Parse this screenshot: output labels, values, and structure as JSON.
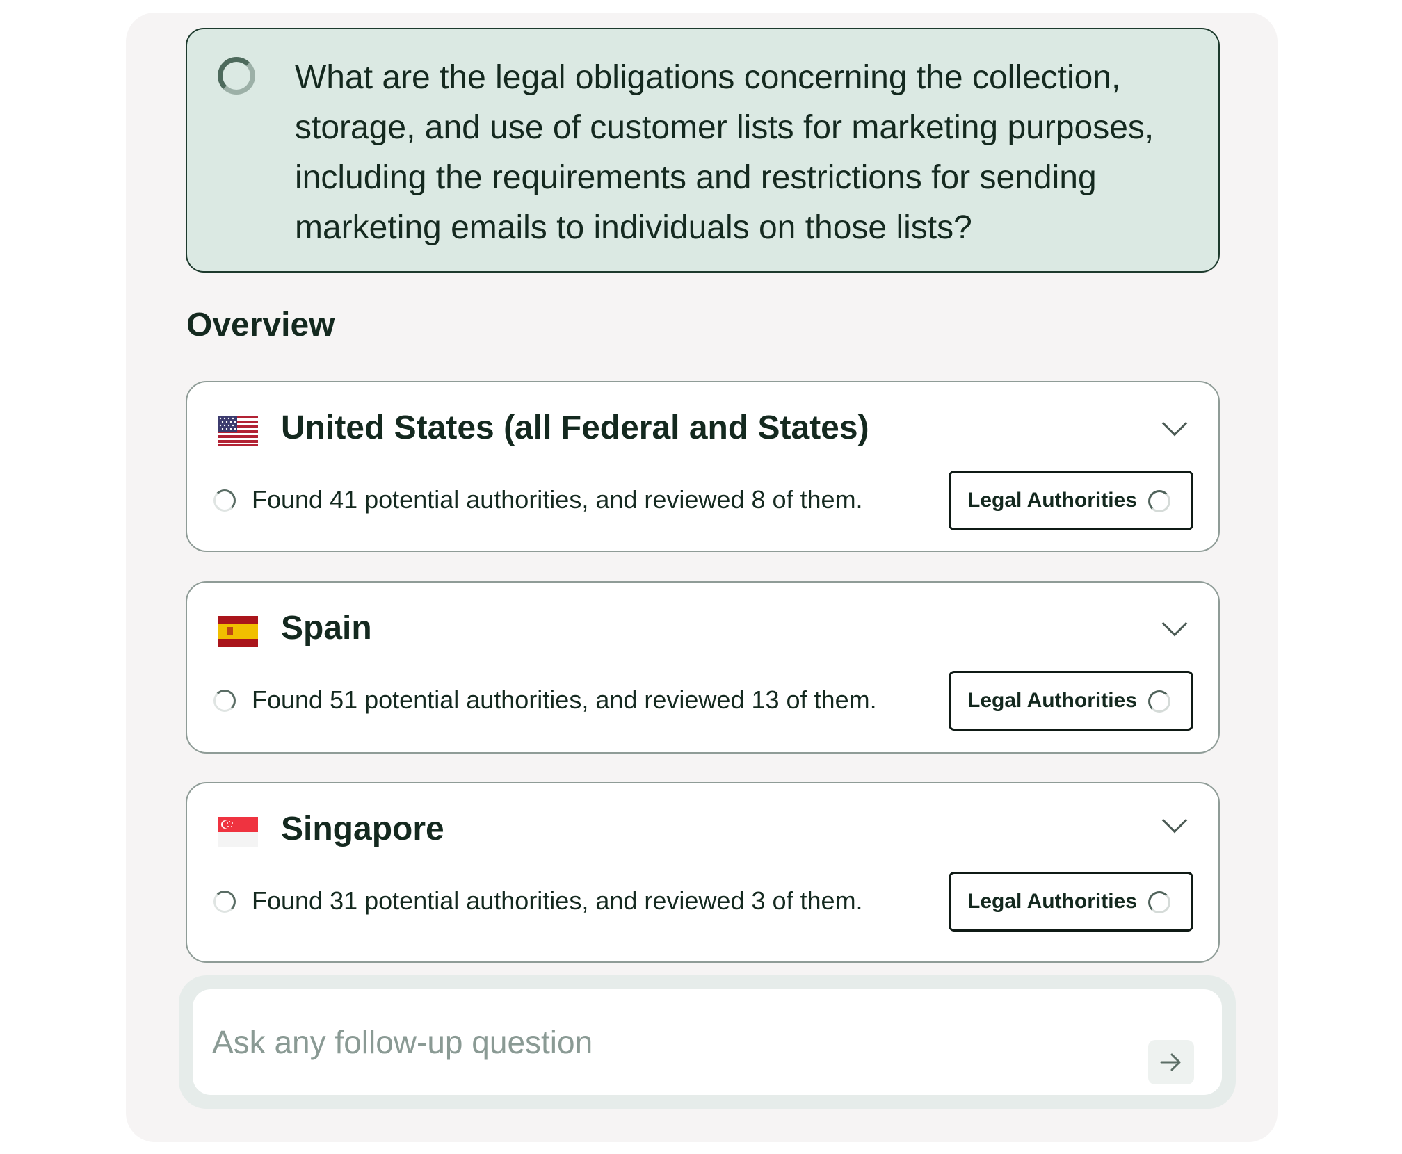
{
  "question": {
    "text": "What are the legal obligations concerning the collection, storage, and use of customer lists for marketing purposes, including the requirements and restrictions for sending marketing emails to individuals on those lists?"
  },
  "overview": {
    "heading": "Overview",
    "jurisdictions": [
      {
        "name": "United States (all Federal and States)",
        "flag": "us-flag-icon",
        "status": "Found 41 potential authorities, and reviewed 8 of them.",
        "button_label": "Legal Authorities"
      },
      {
        "name": "Spain",
        "flag": "spain-flag-icon",
        "status": "Found 51 potential authorities, and reviewed 13 of them.",
        "button_label": "Legal Authorities"
      },
      {
        "name": "Singapore",
        "flag": "singapore-flag-icon",
        "status": "Found 31 potential authorities, and reviewed 3 of them.",
        "button_label": "Legal Authorities"
      }
    ]
  },
  "follow_up": {
    "placeholder": "Ask any follow-up question"
  },
  "colors": {
    "panel_bg": "#f6f4f4",
    "question_bg": "#dbe9e3",
    "text_dark": "#14291f",
    "placeholder": "#8a9a94"
  }
}
